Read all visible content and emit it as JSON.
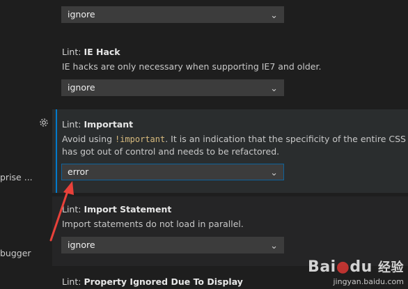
{
  "sidebar": {
    "items": [
      {
        "label": "prise ..."
      },
      {
        "label": "bugger"
      }
    ]
  },
  "settings": [
    {
      "category": "",
      "name": "",
      "description": "",
      "value": "ignore"
    },
    {
      "category": "Lint: ",
      "name": "IE Hack",
      "description": "IE hacks are only necessary when supporting IE7 and older.",
      "value": "ignore"
    },
    {
      "category": "Lint: ",
      "name": "Important",
      "description_pre": "Avoid using ",
      "description_code": "!important",
      "description_post": ". It is an indication that the specificity of the entire CSS has got out of control and needs to be refactored.",
      "value": "error"
    },
    {
      "category": "Lint: ",
      "name": "Import Statement",
      "description": "Import statements do not load in parallel.",
      "value": "ignore"
    },
    {
      "category": "Lint: ",
      "name": "Property Ignored Due To Display"
    }
  ],
  "colors": {
    "background": "#1e1e1e",
    "active_row": "#2a2d2e",
    "accent": "#007acc",
    "arrow": "#e8413a"
  },
  "watermark": {
    "brand": "Bai",
    "brand2": "du",
    "suffix": "经验",
    "url": "jingyan.baidu.com"
  }
}
